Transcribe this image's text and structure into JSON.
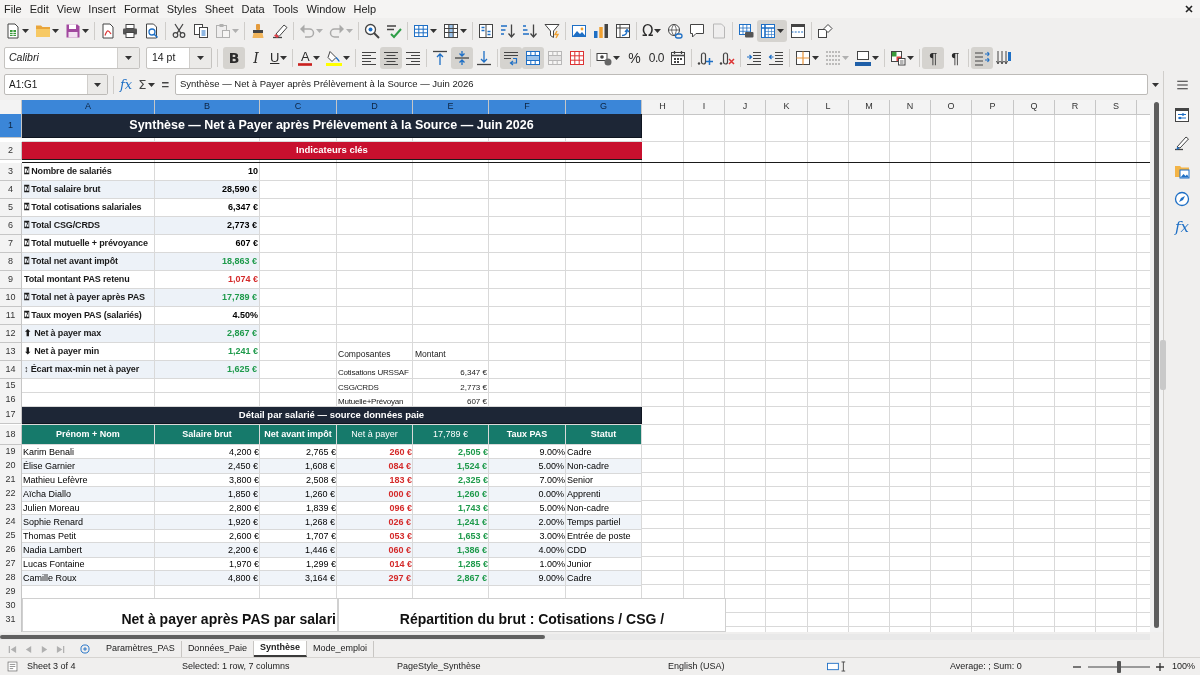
{
  "menu_bar": [
    "File",
    "Edit",
    "View",
    "Insert",
    "Format",
    "Styles",
    "Sheet",
    "Data",
    "Tools",
    "Window",
    "Help"
  ],
  "toolbars": {
    "standard": [
      [
        {
          "kind": "new",
          "pressed": false,
          "disabled": false,
          "dropdown": true
        },
        {
          "kind": "open",
          "pressed": false,
          "disabled": false,
          "dropdown": true
        },
        {
          "kind": "save",
          "pressed": false,
          "disabled": false,
          "dropdown": true
        }
      ],
      [
        {
          "kind": "pdf",
          "pressed": false,
          "disabled": false
        },
        {
          "kind": "print",
          "pressed": false,
          "disabled": false
        },
        {
          "kind": "preview",
          "pressed": false,
          "disabled": false
        }
      ],
      [
        {
          "kind": "cut",
          "pressed": false,
          "disabled": false
        },
        {
          "kind": "copy",
          "pressed": false,
          "disabled": false
        },
        {
          "kind": "paste",
          "pressed": false,
          "disabled": true,
          "dropdown": true
        }
      ],
      [
        {
          "kind": "clone",
          "pressed": false,
          "disabled": false
        },
        {
          "kind": "clear",
          "pressed": false,
          "disabled": false
        }
      ],
      [
        {
          "kind": "undo",
          "pressed": false,
          "disabled": true,
          "dropdown": true
        },
        {
          "kind": "redo",
          "pressed": false,
          "disabled": true,
          "dropdown": true
        }
      ],
      [
        {
          "kind": "find",
          "pressed": false,
          "disabled": false
        },
        {
          "kind": "spelling",
          "pressed": false,
          "disabled": false
        }
      ],
      [
        {
          "kind": "rows",
          "pressed": false,
          "disabled": false,
          "dropdown": true
        },
        {
          "kind": "columns",
          "pressed": false,
          "disabled": false,
          "dropdown": true
        }
      ],
      [
        {
          "kind": "sort",
          "pressed": false,
          "disabled": false
        },
        {
          "kind": "sort_asc",
          "pressed": false,
          "disabled": false
        },
        {
          "kind": "sort_desc",
          "pressed": false,
          "disabled": false
        },
        {
          "kind": "autofilter",
          "pressed": false,
          "disabled": false
        }
      ],
      [
        {
          "kind": "image",
          "pressed": false,
          "disabled": false
        },
        {
          "kind": "chart",
          "pressed": false,
          "disabled": false
        },
        {
          "kind": "pivot",
          "pressed": false,
          "disabled": false
        }
      ],
      [
        {
          "kind": "special",
          "glyph": "Ω",
          "pressed": false,
          "disabled": false,
          "dropdown": true
        },
        {
          "kind": "hyperlink",
          "pressed": false,
          "disabled": false
        },
        {
          "kind": "comment",
          "pressed": false,
          "disabled": false
        },
        {
          "kind": "header_footer",
          "pressed": false,
          "disabled": true
        }
      ],
      [
        {
          "kind": "print_area",
          "pressed": false,
          "disabled": false
        },
        {
          "kind": "freeze",
          "pressed": true,
          "disabled": false,
          "dropdown": true
        },
        {
          "kind": "split",
          "pressed": false,
          "disabled": false
        }
      ],
      [
        {
          "kind": "draw",
          "pressed": false,
          "disabled": false
        }
      ]
    ],
    "formatting": [
      [
        {
          "kind": "bold",
          "glyph": "B",
          "pressed": true,
          "disabled": false
        },
        {
          "kind": "italic",
          "glyph": "I",
          "pressed": false,
          "disabled": false
        },
        {
          "kind": "underline",
          "glyph": "U",
          "pressed": false,
          "disabled": false,
          "dropdown": true
        }
      ],
      [
        {
          "kind": "font_color",
          "glyph": "A",
          "pressed": false,
          "disabled": false,
          "dropdown": true
        },
        {
          "kind": "highlight",
          "pressed": false,
          "disabled": false,
          "dropdown": true
        }
      ],
      [
        {
          "kind": "align_left",
          "pressed": false,
          "disabled": false
        },
        {
          "kind": "align_center",
          "pressed": true,
          "disabled": false
        },
        {
          "kind": "align_right",
          "pressed": false,
          "disabled": false
        }
      ],
      [
        {
          "kind": "align_top",
          "pressed": false,
          "disabled": false
        },
        {
          "kind": "align_middle",
          "pressed": true,
          "disabled": false
        },
        {
          "kind": "align_bottom",
          "pressed": false,
          "disabled": false
        }
      ],
      [
        {
          "kind": "wrap",
          "pressed": true,
          "disabled": false
        },
        {
          "kind": "merge_center",
          "pressed": true,
          "disabled": false
        },
        {
          "kind": "merge",
          "pressed": false,
          "disabled": true
        },
        {
          "kind": "unmerge",
          "pressed": false,
          "disabled": false
        }
      ],
      [
        {
          "kind": "currency",
          "pressed": false,
          "disabled": false,
          "dropdown": true
        },
        {
          "kind": "percent",
          "glyph": "%",
          "pressed": false,
          "disabled": false
        },
        {
          "kind": "number",
          "glyph": "0.0",
          "pressed": false,
          "disabled": false
        },
        {
          "kind": "date",
          "pressed": false,
          "disabled": false
        }
      ],
      [
        {
          "kind": "add_decimal",
          "pressed": false,
          "disabled": false
        },
        {
          "kind": "del_decimal",
          "pressed": false,
          "disabled": false
        }
      ],
      [
        {
          "kind": "indent_inc",
          "pressed": false,
          "disabled": false
        },
        {
          "kind": "indent_dec",
          "pressed": false,
          "disabled": false
        }
      ],
      [
        {
          "kind": "borders",
          "pressed": false,
          "disabled": false,
          "dropdown": true
        },
        {
          "kind": "border_style",
          "pressed": false,
          "disabled": true,
          "dropdown": true
        },
        {
          "kind": "border_color",
          "pressed": false,
          "disabled": false,
          "dropdown": true
        }
      ],
      [
        {
          "kind": "cond_format",
          "pressed": false,
          "disabled": false,
          "dropdown": true
        }
      ],
      [
        {
          "kind": "ltr",
          "glyph": "¶",
          "pressed": true,
          "disabled": false
        },
        {
          "kind": "rtl",
          "glyph": "¶",
          "pressed": false,
          "disabled": false
        }
      ],
      [
        {
          "kind": "text_dir",
          "pressed": true,
          "disabled": false
        },
        {
          "kind": "vertical",
          "pressed": false,
          "disabled": false
        }
      ]
    ]
  },
  "font": {
    "name": "Calibri",
    "size": "14 pt"
  },
  "formula_bar": {
    "name_box": "A1:G1",
    "wizard": "fx",
    "sum": "Σ",
    "equals": "=",
    "content": "Synthèse — Net à Payer après Prélèvement à la Source — Juin 2026"
  },
  "sheet": {
    "column_headers": [
      {
        "label": "A",
        "selected": true
      },
      {
        "label": "B",
        "selected": true
      },
      {
        "label": "C",
        "selected": true
      },
      {
        "label": "D",
        "selected": true
      },
      {
        "label": "E",
        "selected": true
      },
      {
        "label": "F",
        "selected": true
      },
      {
        "label": "G",
        "selected": true
      },
      {
        "label": "H",
        "selected": false
      },
      {
        "label": "I",
        "selected": false
      },
      {
        "label": "J",
        "selected": false
      },
      {
        "label": "K",
        "selected": false
      },
      {
        "label": "L",
        "selected": false
      },
      {
        "label": "M",
        "selected": false
      },
      {
        "label": "N",
        "selected": false
      },
      {
        "label": "O",
        "selected": false
      },
      {
        "label": "P",
        "selected": false
      },
      {
        "label": "Q",
        "selected": false
      },
      {
        "label": "R",
        "selected": false
      },
      {
        "label": "S",
        "selected": false
      }
    ],
    "row_headers": [
      {
        "label": "1",
        "selected": true
      },
      {
        "label": "2",
        "selected": false
      },
      {
        "label": "3",
        "selected": false
      },
      {
        "label": "4",
        "selected": false
      },
      {
        "label": "5",
        "selected": false
      },
      {
        "label": "6",
        "selected": false
      },
      {
        "label": "7",
        "selected": false
      },
      {
        "label": "8",
        "selected": false
      },
      {
        "label": "9",
        "selected": false
      },
      {
        "label": "10",
        "selected": false
      },
      {
        "label": "11",
        "selected": false
      },
      {
        "label": "12",
        "selected": false
      },
      {
        "label": "13",
        "selected": false
      },
      {
        "label": "14",
        "selected": false
      },
      {
        "label": "15",
        "selected": false
      },
      {
        "label": "16",
        "selected": false
      },
      {
        "label": "17",
        "selected": false
      },
      {
        "label": "18",
        "selected": false
      },
      {
        "label": "19",
        "selected": false
      },
      {
        "label": "20",
        "selected": false
      },
      {
        "label": "21",
        "selected": false
      },
      {
        "label": "22",
        "selected": false
      },
      {
        "label": "23",
        "selected": false
      },
      {
        "label": "24",
        "selected": false
      },
      {
        "label": "25",
        "selected": false
      },
      {
        "label": "26",
        "selected": false
      },
      {
        "label": "27",
        "selected": false
      },
      {
        "label": "28",
        "selected": false
      },
      {
        "label": "29",
        "selected": false
      },
      {
        "label": "30",
        "selected": false
      },
      {
        "label": "31",
        "selected": false
      }
    ],
    "title": "Synthèse — Net à Payer après Prélèvement à la Source — Juin 2026",
    "section_title": "Indicateurs clés",
    "indicators": [
      {
        "label": "⍰ Nombre de salariés",
        "value": "10",
        "color": "#000000"
      },
      {
        "label": "⍰ Total salaire brut",
        "value": "28,590 €",
        "color": "#000000"
      },
      {
        "label": "⍰ Total cotisations salariales",
        "value": "6,347 €",
        "color": "#000000"
      },
      {
        "label": "⍰ Total CSG/CRDS",
        "value": "2,773 €",
        "color": "#000000"
      },
      {
        "label": "⍰ Total mutuelle + prévoyance",
        "value": "607 €",
        "color": "#000000"
      },
      {
        "label": "⍰ Total net avant impôt",
        "value": "18,863 €",
        "color": "#1e9a4b"
      },
      {
        "label": "Total montant PAS retenu",
        "value": "1,074 €",
        "color": "#d42a2a"
      },
      {
        "label": "⍰ Total net à payer après PAS",
        "value": "17,789 €",
        "color": "#1e9a4b"
      },
      {
        "label": "⍰ Taux moyen PAS (salariés)",
        "value": "4.50%",
        "color": "#000000"
      },
      {
        "label": "⬆ Net à payer max",
        "value": "2,867 €",
        "color": "#1e9a4b"
      },
      {
        "label": "⬇ Net à payer min",
        "value": "1,241 €",
        "color": "#1e9a4b"
      },
      {
        "label": "↕ Écart max-min net à payer",
        "value": "1,625 €",
        "color": "#1e9a4b"
      }
    ],
    "components": {
      "columns": [
        "Composantes",
        "Montant"
      ],
      "rows": [
        [
          "Cotisations URSSAF",
          "6,347 €"
        ],
        [
          "CSG/CRDS",
          "2,773 €"
        ],
        [
          "Mutuelle+Prévoyan",
          "607 €"
        ]
      ]
    },
    "detail_title": "Détail par salarié — source données paie",
    "detail_columns": [
      {
        "label": "Prénom + Nom",
        "bold": true
      },
      {
        "label": "Salaire brut",
        "bold": true
      },
      {
        "label": "Net avant impôt",
        "bold": true
      },
      {
        "label": "Net à payer",
        "bold": false,
        "color": "#d42a2a"
      },
      {
        "label": "17,789 €",
        "bold": false,
        "color": "#1e9a4b"
      },
      {
        "label": "Taux PAS",
        "bold": true
      },
      {
        "label": "Statut",
        "bold": true
      }
    ],
    "detail_rows": [
      [
        "Karim Benali",
        "4,200 €",
        "2,765 €",
        "260 €",
        "2,505 €",
        "9.00%",
        "Cadre"
      ],
      [
        "Élise Garnier",
        "2,450 €",
        "1,608 €",
        "084 €",
        "1,524 €",
        "5.00%",
        "Non-cadre"
      ],
      [
        "Mathieu Lefèvre",
        "3,800 €",
        "2,508 €",
        "183 €",
        "2,325 €",
        "7.00%",
        "Senior"
      ],
      [
        "Aïcha Diallo",
        "1,850 €",
        "1,260 €",
        "000 €",
        "1,260 €",
        "0.00%",
        "Apprenti"
      ],
      [
        "Julien Moreau",
        "2,800 €",
        "1,839 €",
        "096 €",
        "1,743 €",
        "5.00%",
        "Non-cadre"
      ],
      [
        "Sophie Renard",
        "1,920 €",
        "1,268 €",
        "026 €",
        "1,241 €",
        "2.00%",
        "Temps partiel"
      ],
      [
        "Thomas Petit",
        "2,600 €",
        "1,707 €",
        "053 €",
        "1,653 €",
        "3.00%",
        "Entrée de poste"
      ],
      [
        "Nadia Lambert",
        "2,200 €",
        "1,446 €",
        "060 €",
        "1,386 €",
        "4.00%",
        "CDD"
      ],
      [
        "Lucas Fontaine",
        "1,970 €",
        "1,299 €",
        "014 €",
        "1,285 €",
        "1.00%",
        "Junior"
      ],
      [
        "Camille Roux",
        "4,800 €",
        "3,164 €",
        "297 €",
        "2,867 €",
        "9.00%",
        "Cadre"
      ]
    ],
    "charts": [
      {
        "title": "Net à payer après PAS par salari"
      },
      {
        "title": "Répartition du brut : Cotisations / CSG /"
      }
    ]
  },
  "sidebar": [
    {
      "kind": "properties"
    },
    {
      "kind": "styles"
    },
    {
      "kind": "gallery"
    },
    {
      "kind": "navigator"
    },
    {
      "kind": "functions",
      "glyph": "fx"
    }
  ],
  "sheet_tabs": [
    {
      "label": "Paramètres_PAS",
      "selected": false
    },
    {
      "label": "Données_Paie",
      "selected": false
    },
    {
      "label": "Synthèse",
      "selected": true
    },
    {
      "label": "Mode_emploi",
      "selected": false
    }
  ],
  "status_bar": {
    "sheet": "Sheet 3 of 4",
    "selection": "Selected: 1 row, 7 columns",
    "page_style": "PageStyle_Synthèse",
    "language": "English (USA)",
    "summary": "Average: ; Sum: 0",
    "zoom": {
      "level": 0.5,
      "reading": "100%"
    }
  }
}
